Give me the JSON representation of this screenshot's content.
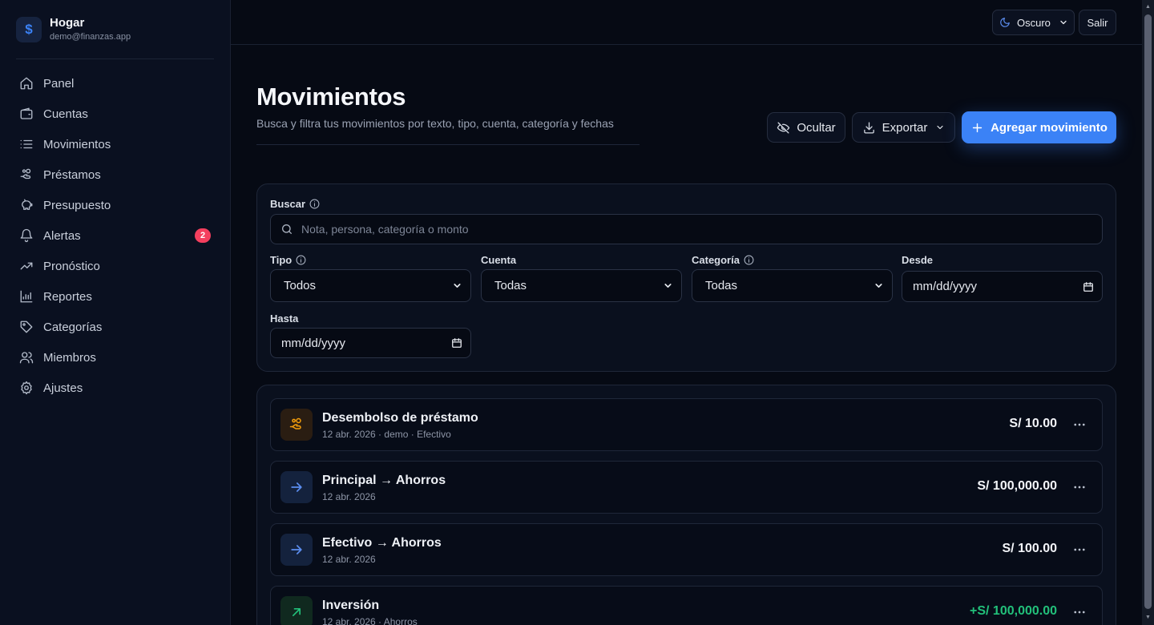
{
  "brand": {
    "name": "Hogar",
    "email": "demo@finanzas.app",
    "logo_glyph": "$"
  },
  "nav": [
    {
      "label": "Panel",
      "icon": "home-icon"
    },
    {
      "label": "Cuentas",
      "icon": "wallet-icon"
    },
    {
      "label": "Movimientos",
      "icon": "list-icon"
    },
    {
      "label": "Préstamos",
      "icon": "hand-coins-icon"
    },
    {
      "label": "Presupuesto",
      "icon": "piggy-bank-icon"
    },
    {
      "label": "Alertas",
      "icon": "bell-icon",
      "badge": "2"
    },
    {
      "label": "Pronóstico",
      "icon": "trending-up-icon"
    },
    {
      "label": "Reportes",
      "icon": "bar-chart-icon"
    },
    {
      "label": "Categorías",
      "icon": "tag-icon"
    },
    {
      "label": "Miembros",
      "icon": "users-icon"
    },
    {
      "label": "Ajustes",
      "icon": "gear-icon"
    }
  ],
  "topbar": {
    "theme_label": "Oscuro",
    "logout_label": "Salir"
  },
  "header": {
    "title": "Movimientos",
    "subtitle": "Busca y filtra tus movimientos por texto, tipo, cuenta, categoría y fechas",
    "hide_label": "Ocultar",
    "export_label": "Exportar",
    "add_label": "Agregar movimiento"
  },
  "filters": {
    "search_label": "Buscar",
    "search_placeholder": "Nota, persona, categoría o monto",
    "type_label": "Tipo",
    "type_value": "Todos",
    "account_label": "Cuenta",
    "account_value": "Todas",
    "category_label": "Categoría",
    "category_value": "Todas",
    "from_label": "Desde",
    "from_value": "mm/dd/yyyy",
    "to_label": "Hasta",
    "to_value": "mm/dd/yyyy"
  },
  "transactions": [
    {
      "title": "Desembolso de préstamo",
      "meta": "12 abr. 2026 · demo · Efectivo",
      "amount": "S/ 10.00",
      "icon": "hand-coins-icon",
      "kind": "loan"
    },
    {
      "title": "Principal → Ahorros",
      "meta": "12 abr. 2026",
      "amount": "S/ 100,000.00",
      "icon": "arrow-right-icon",
      "kind": "transfer"
    },
    {
      "title": "Efectivo → Ahorros",
      "meta": "12 abr. 2026",
      "amount": "S/ 100.00",
      "icon": "arrow-right-icon",
      "kind": "transfer"
    },
    {
      "title": "Inversión",
      "meta": "12 abr. 2026 · Ahorros",
      "amount": "+S/ 100,000.00",
      "icon": "arrow-up-right-icon",
      "kind": "income"
    }
  ],
  "colors": {
    "accent": "#3b82f6",
    "badge": "#f43f5e",
    "income": "#22c07a",
    "loan": "#f59e0b",
    "background": "#060a14",
    "sidebar": "#0a1020"
  }
}
